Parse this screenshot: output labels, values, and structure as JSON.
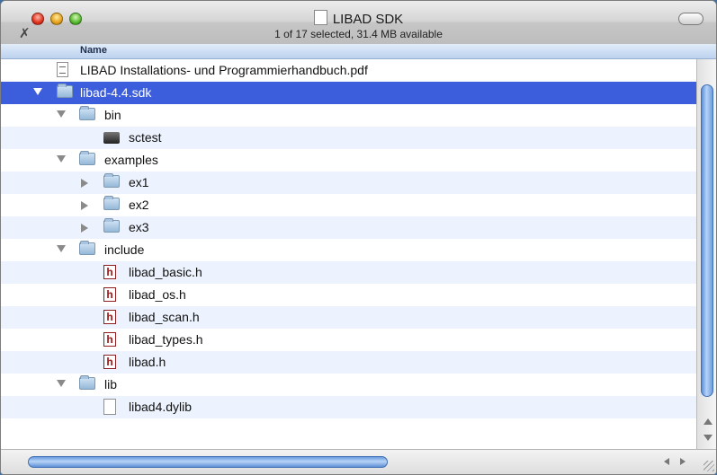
{
  "window": {
    "title": "LIBAD SDK",
    "status": "1 of 17 selected, 31.4 MB available"
  },
  "list": {
    "column_header": "Name",
    "rows": [
      {
        "name": "LIBAD Installations- und Programmierhandbuch.pdf",
        "icon": "pdf-file-icon",
        "depth": 0,
        "disclosure": "none",
        "selected": false
      },
      {
        "name": "libad-4.4.sdk",
        "icon": "folder-icon",
        "depth": 0,
        "disclosure": "expanded",
        "selected": true
      },
      {
        "name": "bin",
        "icon": "folder-icon",
        "depth": 1,
        "disclosure": "expanded",
        "selected": false
      },
      {
        "name": "sctest",
        "icon": "executable-icon",
        "depth": 2,
        "disclosure": "none",
        "selected": false
      },
      {
        "name": "examples",
        "icon": "folder-icon",
        "depth": 1,
        "disclosure": "expanded",
        "selected": false
      },
      {
        "name": "ex1",
        "icon": "folder-icon",
        "depth": 2,
        "disclosure": "collapsed",
        "selected": false
      },
      {
        "name": "ex2",
        "icon": "folder-icon",
        "depth": 2,
        "disclosure": "collapsed",
        "selected": false
      },
      {
        "name": "ex3",
        "icon": "folder-icon",
        "depth": 2,
        "disclosure": "collapsed",
        "selected": false
      },
      {
        "name": "include",
        "icon": "folder-icon",
        "depth": 1,
        "disclosure": "expanded",
        "selected": false
      },
      {
        "name": "libad_basic.h",
        "icon": "header-file-icon",
        "depth": 2,
        "disclosure": "none",
        "selected": false
      },
      {
        "name": "libad_os.h",
        "icon": "header-file-icon",
        "depth": 2,
        "disclosure": "none",
        "selected": false
      },
      {
        "name": "libad_scan.h",
        "icon": "header-file-icon",
        "depth": 2,
        "disclosure": "none",
        "selected": false
      },
      {
        "name": "libad_types.h",
        "icon": "header-file-icon",
        "depth": 2,
        "disclosure": "none",
        "selected": false
      },
      {
        "name": "libad.h",
        "icon": "header-file-icon",
        "depth": 2,
        "disclosure": "none",
        "selected": false
      },
      {
        "name": "lib",
        "icon": "folder-icon",
        "depth": 1,
        "disclosure": "expanded",
        "selected": false
      },
      {
        "name": "libad4.dylib",
        "icon": "document-icon",
        "depth": 2,
        "disclosure": "none",
        "selected": false
      }
    ]
  },
  "header_file_glyph": "h",
  "colors": {
    "selection": "#3c5ddc",
    "alternate_row": "#edf3fe",
    "scroll_thumb": "#6e9de0"
  }
}
